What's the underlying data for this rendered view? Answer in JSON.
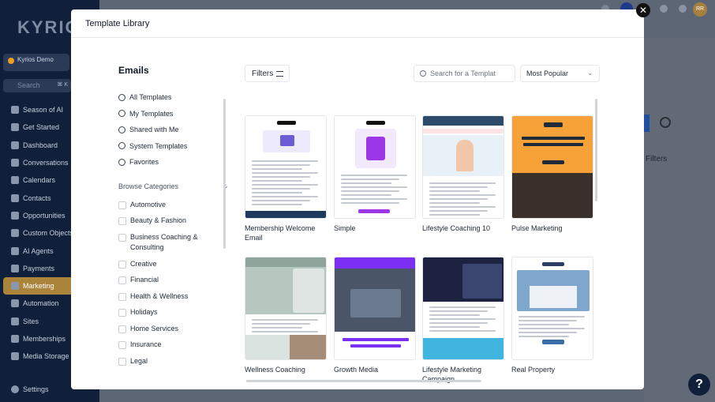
{
  "background_app": {
    "logo_text": "KYRIO",
    "account_name": "Kyrios Demo",
    "search_placeholder": "Search",
    "search_shortcut": "⌘ K",
    "sidebar_items": [
      {
        "label": "Season of AI",
        "active": false
      },
      {
        "label": "Get Started",
        "active": false
      },
      {
        "label": "Dashboard",
        "active": false
      },
      {
        "label": "Conversations",
        "active": false
      },
      {
        "label": "Calendars",
        "active": false
      },
      {
        "label": "Contacts",
        "active": false
      },
      {
        "label": "Opportunities",
        "active": false
      },
      {
        "label": "Custom Objects",
        "active": false
      },
      {
        "label": "AI Agents",
        "active": false
      },
      {
        "label": "Payments",
        "active": false
      },
      {
        "label": "Marketing",
        "active": true
      },
      {
        "label": "Automation",
        "active": false
      },
      {
        "label": "Sites",
        "active": false
      },
      {
        "label": "Memberships",
        "active": false
      },
      {
        "label": "Media Storage",
        "active": false
      }
    ],
    "settings_label": "Settings",
    "avatar_initials": "RR",
    "filters_label": "Filters",
    "help_label": "?"
  },
  "modal": {
    "title": "Template Library",
    "close_icon": "close-icon",
    "left_panel": {
      "heading": "Emails",
      "nav_items": [
        {
          "label": "All Templates",
          "icon": "check-circle-icon"
        },
        {
          "label": "My Templates",
          "icon": "user-icon"
        },
        {
          "label": "Shared with Me",
          "icon": "share-icon"
        },
        {
          "label": "System Templates",
          "icon": "wrench-icon"
        },
        {
          "label": "Favorites",
          "icon": "star-icon"
        }
      ],
      "browse_label": "Browse Categories",
      "categories": [
        "Automotive",
        "Beauty & Fashion",
        "Business Coaching & Consulting",
        "Creative",
        "Financial",
        "Health & Wellness",
        "Holidays",
        "Home Services",
        "Insurance",
        "Legal"
      ]
    },
    "toolbar": {
      "filters_label": "Filters",
      "search_placeholder": "Search for a Templat",
      "sort_value": "Most Popular"
    },
    "templates": [
      {
        "name": "Membership Welcome Email",
        "theme": "#1e3a5f",
        "accent": "#6b5bd6"
      },
      {
        "name": "Simple",
        "theme": "#ffffff",
        "accent": "#9b37e6"
      },
      {
        "name": "Lifestyle Coaching 10",
        "theme": "#2d4a6b",
        "accent": "#e0566b"
      },
      {
        "name": "Pulse Marketing",
        "theme": "#f7a238",
        "accent": "#1f2937"
      },
      {
        "name": "Wellness Coaching",
        "theme": "#b6c7c0",
        "accent": "#2f4f4f"
      },
      {
        "name": "Growth Media",
        "theme": "#7b2ff2",
        "accent": "#7b2ff2"
      },
      {
        "name": "Lifestyle Marketing Campaign",
        "theme": "#1c2240",
        "accent": "#3fb5e0"
      },
      {
        "name": "Real Property",
        "theme": "#2c3e66",
        "accent": "#3b6ea8"
      }
    ]
  }
}
